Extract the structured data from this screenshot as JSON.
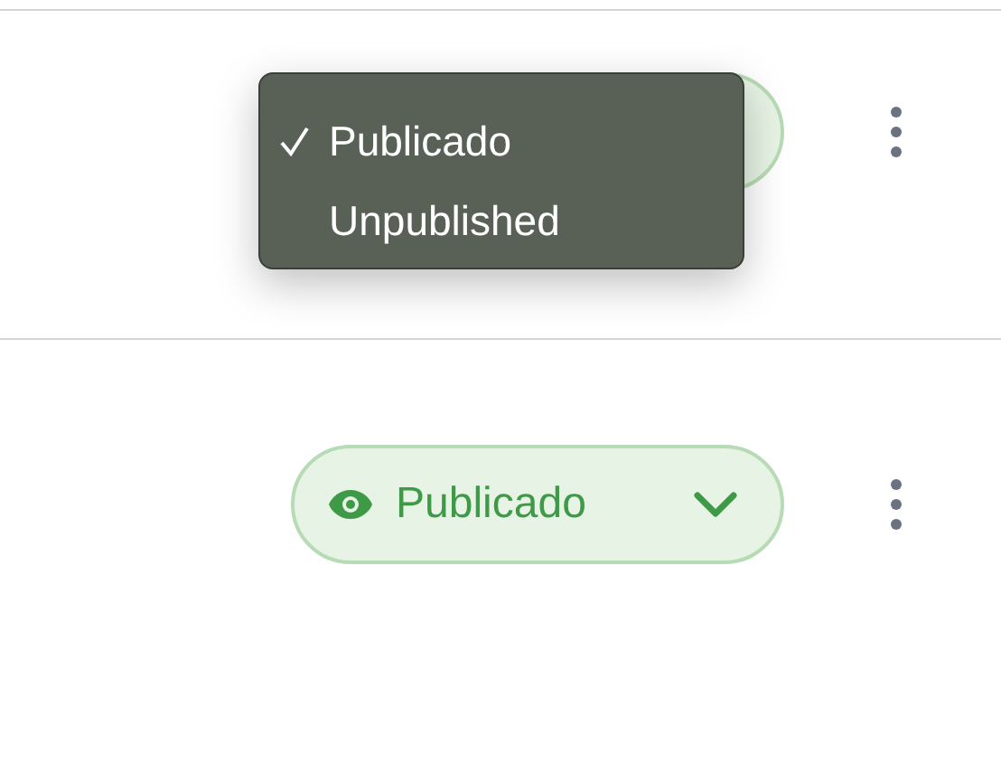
{
  "rows": [
    {
      "status": {
        "kind": "published"
      },
      "status_menu": {
        "open": true,
        "options": [
          {
            "label": "Publicado",
            "selected": true
          },
          {
            "label": "Unpublished",
            "selected": false
          }
        ]
      }
    },
    {
      "status": {
        "kind": "published",
        "label": "Publicado"
      }
    }
  ]
}
